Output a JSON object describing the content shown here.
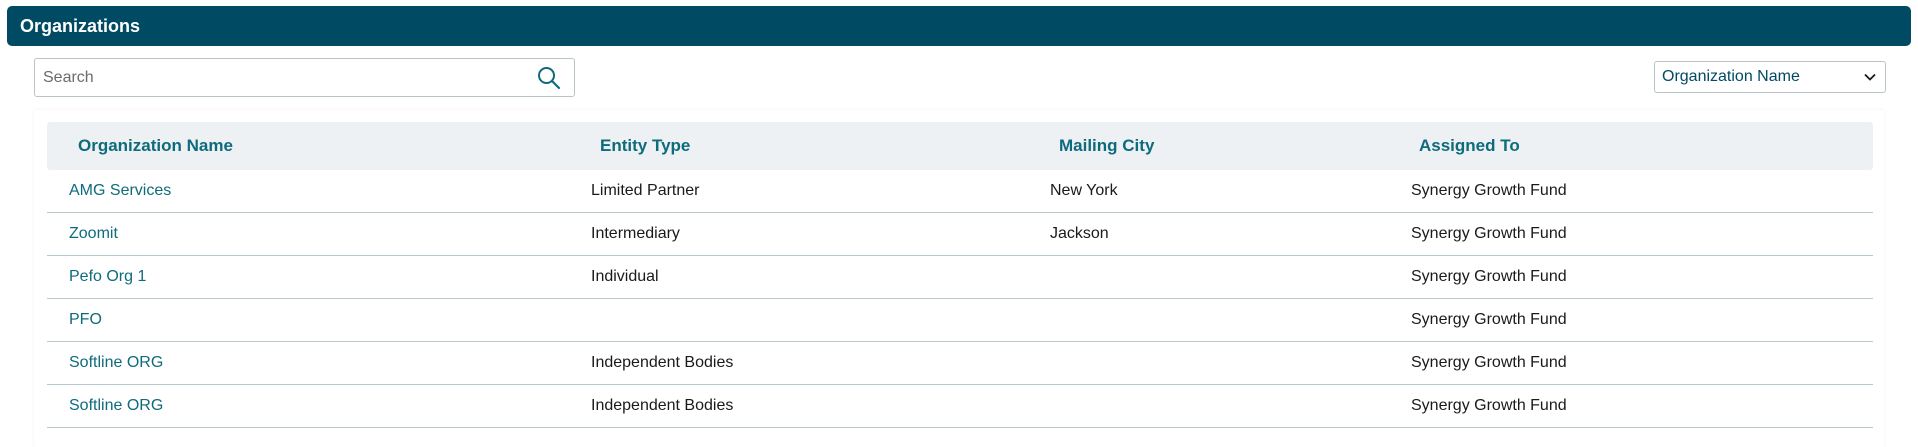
{
  "header": {
    "title": "Organizations"
  },
  "search": {
    "placeholder": "Search",
    "value": ""
  },
  "sort": {
    "selected": "Organization Name"
  },
  "table": {
    "columns": [
      "Organization Name",
      "Entity Type",
      "Mailing City",
      "Assigned To"
    ],
    "rows": [
      {
        "name": "AMG Services",
        "entity_type": "Limited Partner",
        "city": "New York",
        "assigned": "Synergy Growth Fund"
      },
      {
        "name": "Zoomit",
        "entity_type": "Intermediary",
        "city": "Jackson",
        "assigned": "Synergy Growth Fund"
      },
      {
        "name": "Pefo Org 1",
        "entity_type": "Individual",
        "city": "",
        "assigned": "Synergy Growth Fund"
      },
      {
        "name": "PFO",
        "entity_type": "",
        "city": "",
        "assigned": "Synergy Growth Fund"
      },
      {
        "name": "Softline ORG",
        "entity_type": "Independent Bodies",
        "city": "",
        "assigned": "Synergy Growth Fund"
      },
      {
        "name": "Softline ORG",
        "entity_type": "Independent Bodies",
        "city": "",
        "assigned": "Synergy Growth Fund"
      }
    ]
  },
  "colors": {
    "header_bg": "#004a63",
    "link": "#0e6b7c",
    "table_head_bg": "#edf1f3"
  },
  "icons": {
    "search": "search-icon",
    "dropdown": "chevron-down-icon"
  }
}
